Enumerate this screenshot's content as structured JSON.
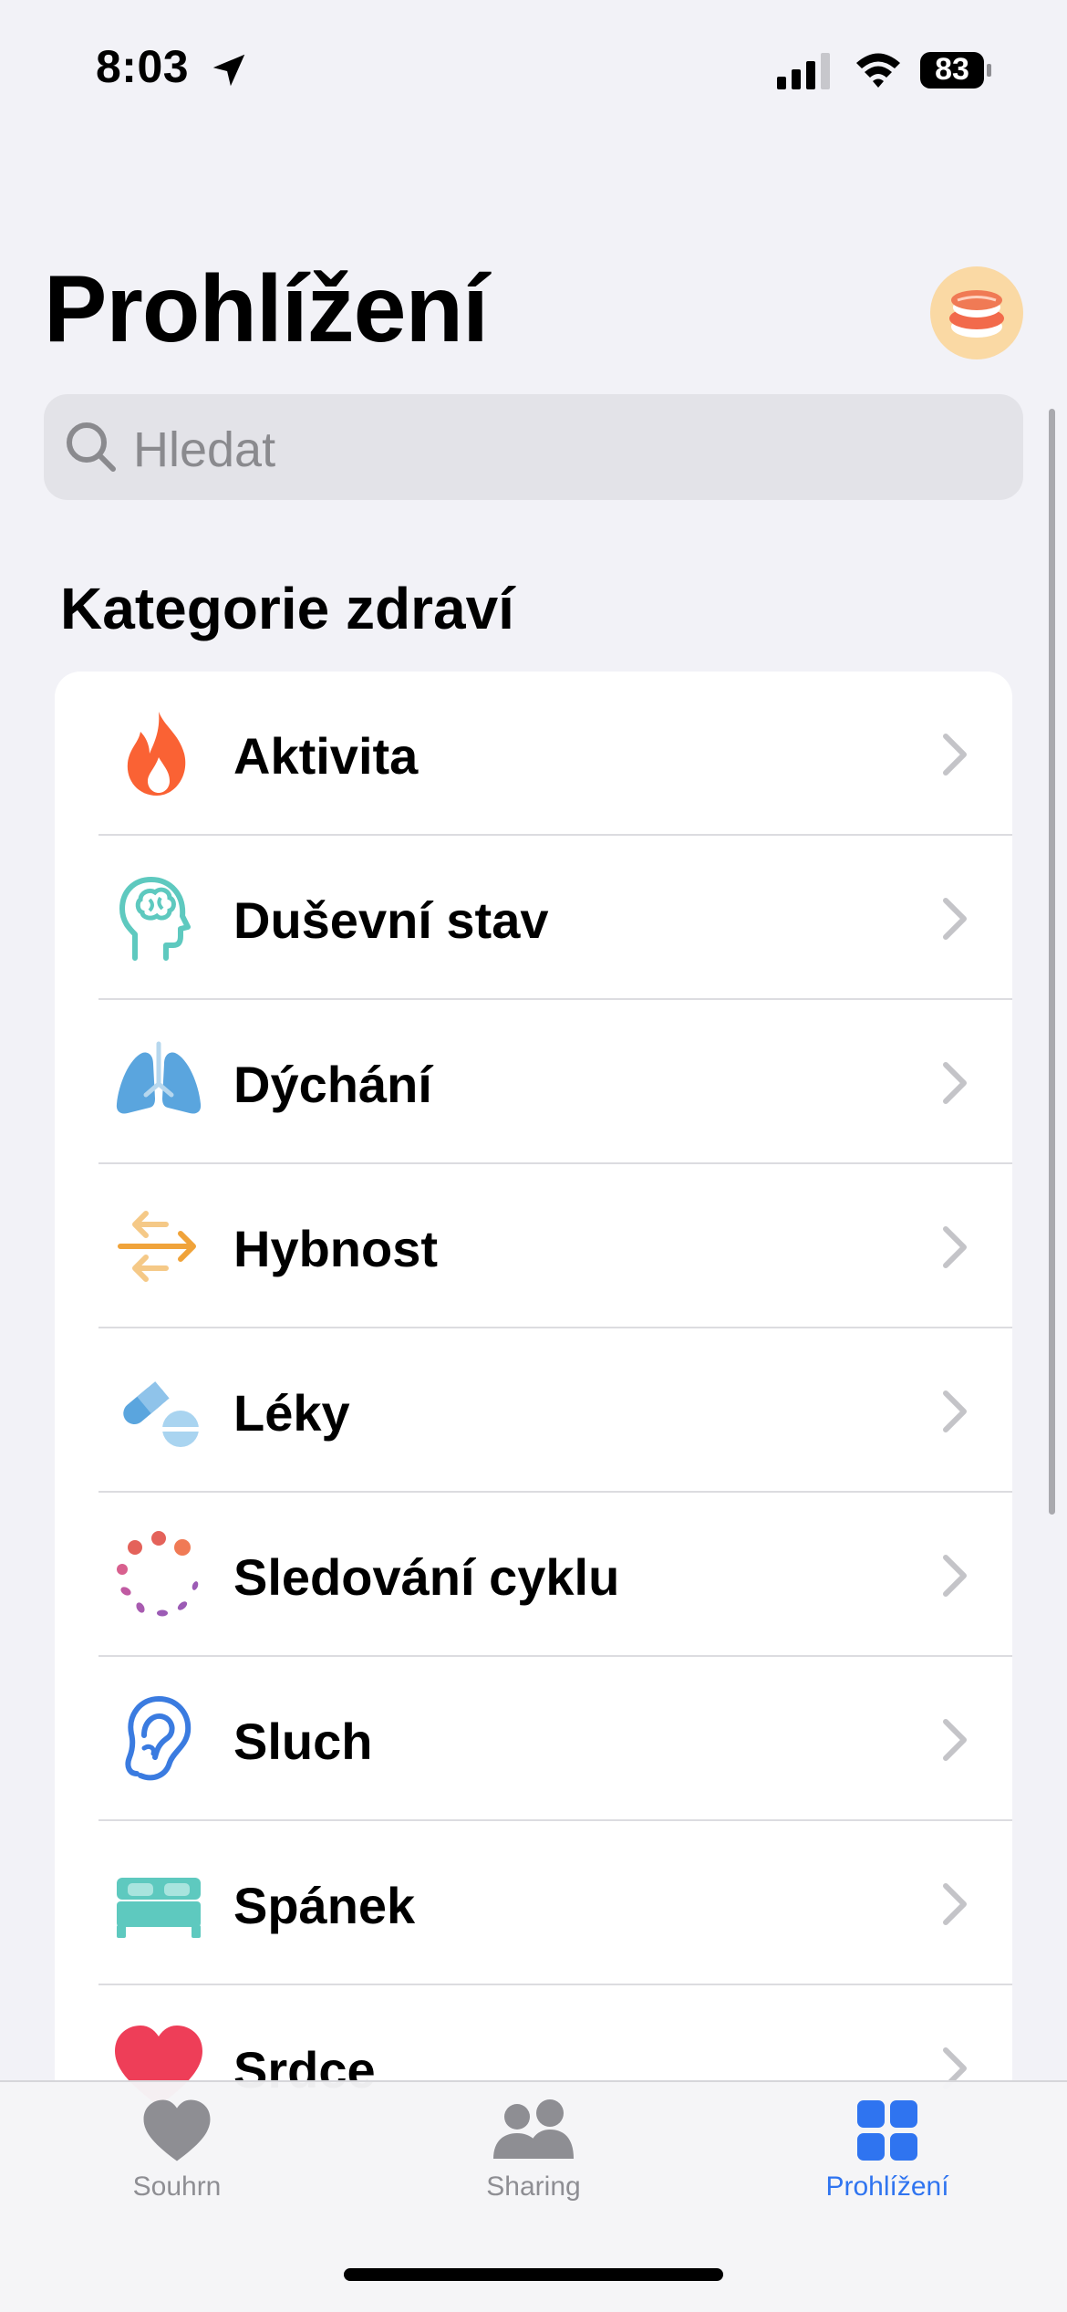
{
  "status_bar": {
    "time": "8:03",
    "battery": "83"
  },
  "header": {
    "title": "Prohlížení"
  },
  "search": {
    "placeholder": "Hledat"
  },
  "section": {
    "title": "Kategorie zdraví"
  },
  "categories": [
    {
      "label": "Aktivita",
      "icon": "flame-icon"
    },
    {
      "label": "Duševní stav",
      "icon": "brain-head-icon"
    },
    {
      "label": "Dýchání",
      "icon": "lungs-icon"
    },
    {
      "label": "Hybnost",
      "icon": "arrows-icon"
    },
    {
      "label": "Léky",
      "icon": "pills-icon"
    },
    {
      "label": "Sledování cyklu",
      "icon": "cycle-icon"
    },
    {
      "label": "Sluch",
      "icon": "ear-icon"
    },
    {
      "label": "Spánek",
      "icon": "bed-icon"
    },
    {
      "label": "Srdce",
      "icon": "heart-icon"
    }
  ],
  "tabs": [
    {
      "label": "Souhrn",
      "icon": "heart-icon"
    },
    {
      "label": "Sharing",
      "icon": "people-icon"
    },
    {
      "label": "Prohlížení",
      "icon": "grid-icon",
      "active": true
    }
  ],
  "colors": {
    "background": "#f2f2f7",
    "accent": "#2f74f0",
    "activity": "#fa6234",
    "mind": "#5ec9bf",
    "respiration": "#5aa5de",
    "mobility": "#f0a33a",
    "medications": "#5aa5de",
    "hearing": "#3a7be0",
    "sleep": "#5ec9bf",
    "heart": "#ee3e58"
  }
}
